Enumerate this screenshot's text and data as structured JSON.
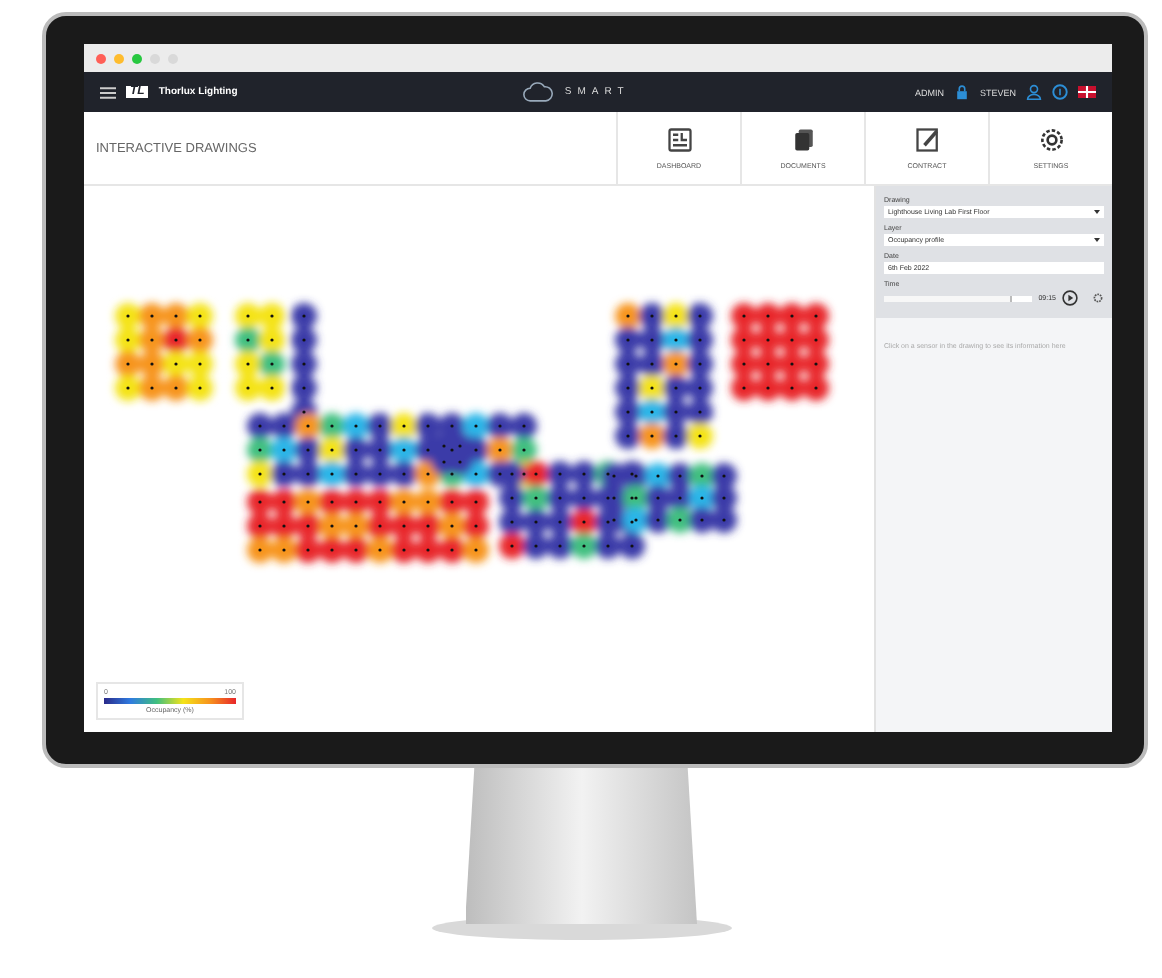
{
  "browser": {
    "dots": [
      {
        "color": "#ff5f57"
      },
      {
        "color": "#febc2e"
      },
      {
        "color": "#28c840"
      },
      {
        "color": "#d9d9d9"
      },
      {
        "color": "#d9d9d9"
      }
    ]
  },
  "navbar": {
    "logo_mark": "TL",
    "logo_text": "Thorlux Lighting",
    "brand": "SMART",
    "user_role": "ADMIN",
    "user_name": "STEVEN"
  },
  "page": {
    "title": "INTERACTIVE DRAWINGS"
  },
  "toolbar": [
    {
      "label": "DASHBOARD",
      "kind": "dashboard",
      "selected": false
    },
    {
      "label": "DOCUMENTS",
      "kind": "documents",
      "selected": false
    },
    {
      "label": "CONTRACT",
      "kind": "contract",
      "selected": false
    },
    {
      "label": "SETTINGS",
      "kind": "settings",
      "selected": false
    }
  ],
  "legend": {
    "min": "0",
    "max": "100",
    "label": "Occupancy (%)"
  },
  "sidebar": {
    "fields": [
      {
        "kind": "select",
        "label": "Drawing",
        "value": "Lighthouse Living Lab First Floor"
      },
      {
        "kind": "select",
        "label": "Layer",
        "value": "Occupancy profile"
      },
      {
        "kind": "text",
        "label": "Date",
        "value": "6th Feb 2022"
      },
      {
        "kind": "slider",
        "label": "Time",
        "value": "09:15",
        "level": 0.85
      }
    ],
    "hint": "Click on a sensor in the drawing to see its information here"
  }
}
